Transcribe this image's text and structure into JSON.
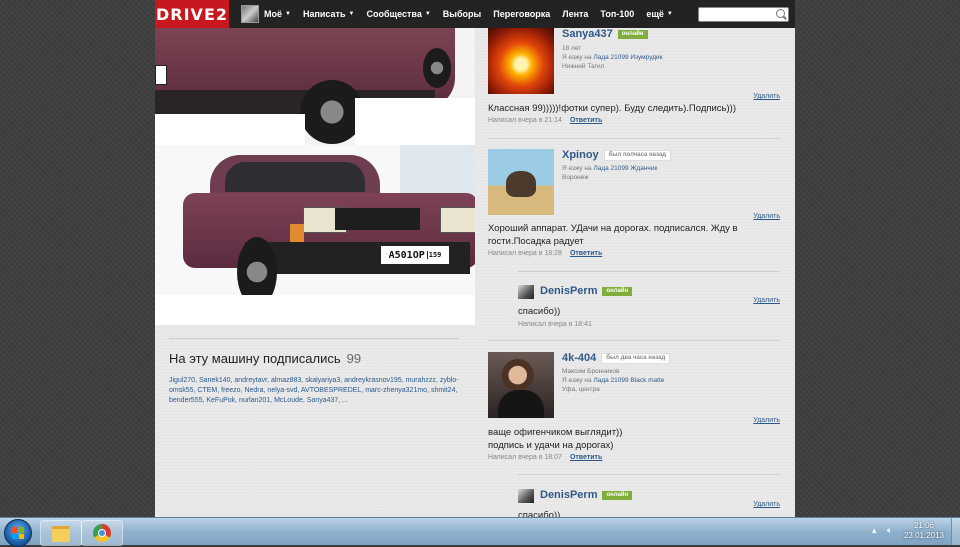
{
  "site": {
    "logo": "DRIVE2",
    "nav": [
      {
        "label": "Моё",
        "caret": true
      },
      {
        "label": "Написать",
        "caret": true
      },
      {
        "label": "Сообщества",
        "caret": true
      },
      {
        "label": "Выборы",
        "caret": false
      },
      {
        "label": "Переговорка",
        "caret": false
      },
      {
        "label": "Лента",
        "caret": false
      },
      {
        "label": "Топ-100",
        "caret": false
      },
      {
        "label": "ещё",
        "caret": true
      }
    ],
    "search_placeholder": ""
  },
  "car": {
    "plate_number": "A501OP",
    "plate_region": "159"
  },
  "subscribers": {
    "title": "На эту машину подписались",
    "count": "99",
    "list": "Jigul270, Sanek140, andreytavr, almaz883, skalyariya3, andreykrasnov195, murahzzz, zyblo-omsk55, CTEM, freezo, Nedra, nelya-svd, AVTOBESPREDEL, marc-zhenya321mo, shmit24, bender555, KeFuPok, nurlan201, McLoude, Sanya437, ...",
    "ellipsis": "..."
  },
  "comments": [
    {
      "name": "Sanya437",
      "status": "онлайн",
      "age": "18 лет",
      "drives_prefix": "Я езжу на",
      "car": "Лада 21099 Изумрудик",
      "city": "Нижний Тагил",
      "text": "Классная 99)))))!фотки супер). Буду следить).Подпись)))",
      "posted": "Написал вчера в 21:14",
      "reply": "Ответить",
      "delete": "Удалить"
    },
    {
      "name": "Xpinoy",
      "status": "был полчаса назад",
      "drives_prefix": "Я езжу на",
      "car": "Лада 21099 Жданчик",
      "city": "Воронеж",
      "text": "Хороший аппарат. УДачи на дорогах. подписался. Жду в гости.Посадка радует",
      "posted": "Написал вчера в 18:28",
      "reply": "Ответить",
      "delete": "Удалить"
    },
    {
      "name": "DenisPerm",
      "status": "онлайн",
      "text": "спасибо))",
      "posted": "Написал вчера в 18:41",
      "delete": "Удалить"
    },
    {
      "name": "4k-404",
      "status": "был два часа назад",
      "real_name": "Максим Бронников",
      "drives_prefix": "Я езжу на",
      "car": "Лада 21099 Black matte",
      "city": "Уфа, центра",
      "text_line1": "ваще офигенчиком выглядит))",
      "text_line2": "подпись и удачи на дорогах)",
      "posted": "Написал вчера в 18:07",
      "reply": "Ответить",
      "delete": "Удалить"
    },
    {
      "name": "DenisPerm",
      "status": "онлайн",
      "text": "спасибо))",
      "delete": "Удалить"
    }
  ],
  "taskbar": {
    "time": "21:06",
    "date": "23.01.2013"
  }
}
